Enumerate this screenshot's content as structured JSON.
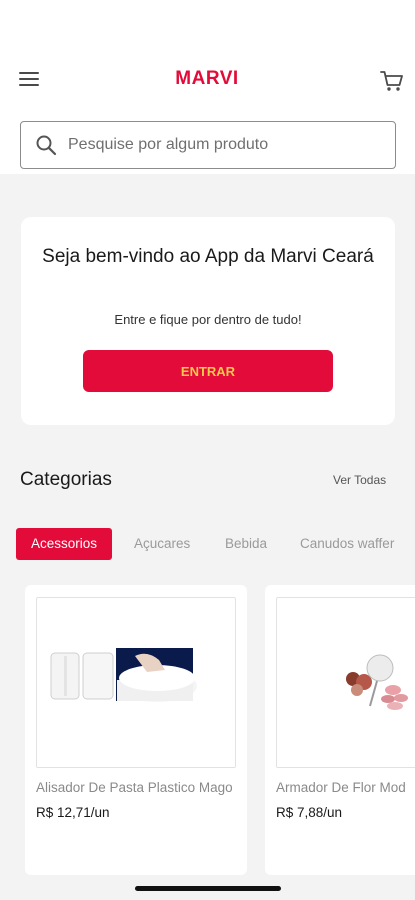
{
  "header": {
    "logo_text": "MARVI",
    "menu_icon": "hamburger-menu-icon",
    "cart_icon": "shopping-cart-icon"
  },
  "search": {
    "placeholder": "Pesquise por algum produto",
    "icon": "search-icon"
  },
  "welcome": {
    "title": "Seja bem-vindo ao App da Marvi Ceará",
    "subtitle": "Entre e fique por dentro de tudo!",
    "button_label": "ENTRAR"
  },
  "categories": {
    "title": "Categorias",
    "see_all": "Ver Todas",
    "chips": [
      {
        "label": "Acessorios",
        "active": true
      },
      {
        "label": "Açucares",
        "active": false
      },
      {
        "label": "Bebida",
        "active": false
      },
      {
        "label": "Canudos waffer",
        "active": false
      }
    ]
  },
  "products": [
    {
      "name": "Alisador De Pasta Plastico Mago",
      "price": "R$ 12,71/un"
    },
    {
      "name": "Armador De Flor Mod",
      "price": "R$ 7,88/un"
    }
  ],
  "colors": {
    "brand": "#e30b3a",
    "button_text": "#f2c94c",
    "background": "#f3f3f3"
  }
}
